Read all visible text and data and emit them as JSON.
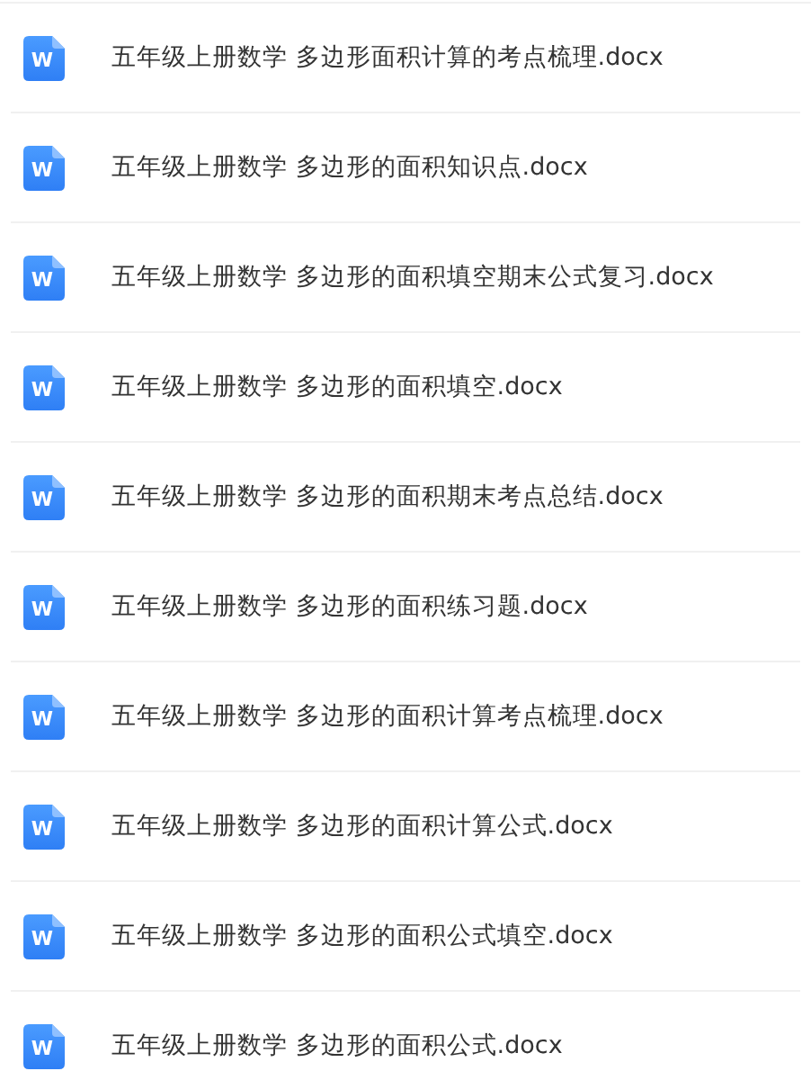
{
  "files": [
    {
      "icon": "W",
      "name": "五年级上册数学 多边形面积计算的考点梳理.docx"
    },
    {
      "icon": "W",
      "name": "五年级上册数学 多边形的面积知识点.docx"
    },
    {
      "icon": "W",
      "name": "五年级上册数学 多边形的面积填空期末公式复习.docx"
    },
    {
      "icon": "W",
      "name": "五年级上册数学 多边形的面积填空.docx"
    },
    {
      "icon": "W",
      "name": "五年级上册数学 多边形的面积期末考点总结.docx"
    },
    {
      "icon": "W",
      "name": "五年级上册数学 多边形的面积练习题.docx"
    },
    {
      "icon": "W",
      "name": "五年级上册数学 多边形的面积计算考点梳理.docx"
    },
    {
      "icon": "W",
      "name": "五年级上册数学 多边形的面积计算公式.docx"
    },
    {
      "icon": "W",
      "name": "五年级上册数学 多边形的面积公式填空.docx"
    },
    {
      "icon": "W",
      "name": "五年级上册数学 多边形的面积公式.docx"
    }
  ]
}
